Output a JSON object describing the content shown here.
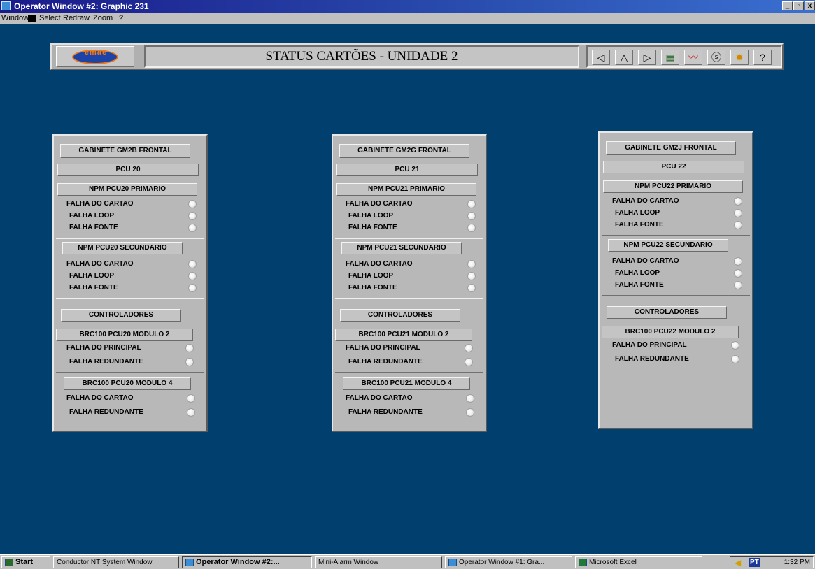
{
  "window": {
    "title": "Operator Window #2: Graphic 231",
    "controls": {
      "minimize": "_",
      "maximize": "▫",
      "close": "x"
    }
  },
  "menu": {
    "items": [
      "Window",
      "Select",
      "Redraw",
      "Zoom",
      "?"
    ]
  },
  "header": {
    "logo_text": "emae",
    "page_title": "STATUS CARTÕES - UNIDADE 2",
    "nav_icons": [
      "left-arrow-icon",
      "up-arrow-icon",
      "right-arrow-icon",
      "overview-icon",
      "trend-icon",
      "refresh-icon",
      "alarm-bell-icon",
      "help-icon"
    ],
    "nav_glyphs": [
      "◁",
      "△",
      "▷",
      "▦",
      "〰",
      "ⓢ",
      "✹",
      "?"
    ]
  },
  "panels": [
    {
      "cabinet": "GABINETE GM2B FRONTAL",
      "pcu": "PCU 20",
      "npm_primary": "NPM PCU20 PRIMARIO",
      "npm_primary_rows": [
        "FALHA DO CARTAO",
        "FALHA LOOP",
        "FALHA FONTE"
      ],
      "npm_secondary": "NPM PCU20  SECUNDARIO",
      "npm_secondary_rows": [
        "FALHA DO CARTAO",
        "FALHA LOOP",
        "FALHA FONTE"
      ],
      "controllers": "CONTROLADORES",
      "brc_a": "BRC100 PCU20 MODULO 2",
      "brc_a_rows": [
        "FALHA DO PRINCIPAL",
        "FALHA REDUNDANTE"
      ],
      "brc_b": "BRC100 PCU20 MODULO 4",
      "brc_b_rows": [
        "FALHA DO CARTAO",
        "FALHA REDUNDANTE"
      ]
    },
    {
      "cabinet": "GABINETE GM2G FRONTAL",
      "pcu": "PCU 21",
      "npm_primary": "NPM PCU21  PRIMARIO",
      "npm_primary_rows": [
        "FALHA DO CARTAO",
        "FALHA LOOP",
        "FALHA FONTE"
      ],
      "npm_secondary": "NPM PCU21 SECUNDARIO",
      "npm_secondary_rows": [
        "FALHA DO CARTAO",
        "FALHA LOOP",
        "FALHA FONTE"
      ],
      "controllers": "CONTROLADORES",
      "brc_a": "BRC100 PCU21 MODULO 2",
      "brc_a_rows": [
        "FALHA DO PRINCIPAL",
        "FALHA REDUNDANTE"
      ],
      "brc_b": "BRC100 PCU21 MODULO 4",
      "brc_b_rows": [
        "FALHA DO CARTAO",
        "FALHA REDUNDANTE"
      ]
    },
    {
      "cabinet": "GABINETE GM2J FRONTAL",
      "pcu": "PCU 22",
      "npm_primary": "NPM PCU22  PRIMARIO",
      "npm_primary_rows": [
        "FALHA DO CARTAO",
        "FALHA LOOP",
        "FALHA FONTE"
      ],
      "npm_secondary": "NPM PCU22  SECUNDARIO",
      "npm_secondary_rows": [
        "FALHA DO CARTAO",
        "FALHA LOOP",
        "FALHA FONTE"
      ],
      "controllers": "CONTROLADORES",
      "brc_a": "BRC100 PCU22  MODULO 2",
      "brc_a_rows": [
        "FALHA DO PRINCIPAL",
        "FALHA REDUNDANTE"
      ]
    }
  ],
  "taskbar": {
    "start": "Start",
    "items": [
      "Conductor NT System Window",
      "Operator Window #2:...",
      "Mini-Alarm Window",
      "Operator Window #1: Gra...",
      "Microsoft Excel"
    ],
    "lang": "PT",
    "clock": "1:32 PM"
  }
}
